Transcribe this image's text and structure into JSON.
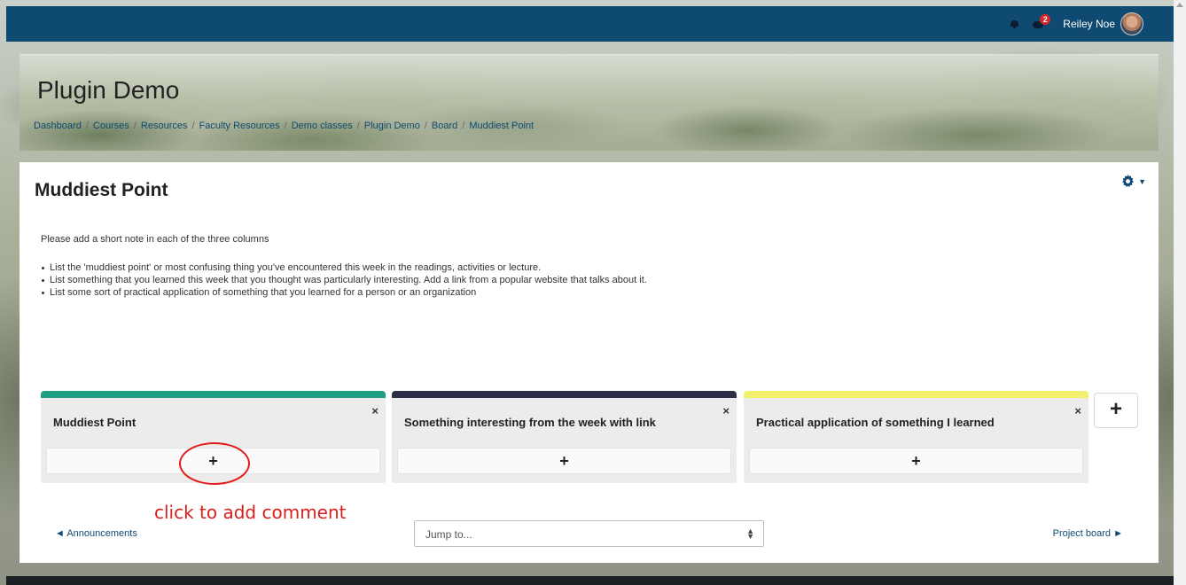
{
  "navbar": {
    "user_name": "Reiley Noe",
    "message_count": "2",
    "colors": {
      "background": "#0f4a72",
      "badge": "#d9262b"
    }
  },
  "header": {
    "page_title": "Plugin Demo",
    "breadcrumb": [
      "Dashboard",
      "Courses",
      "Resources",
      "Faculty Resources",
      "Demo classes",
      "Plugin Demo",
      "Board",
      "Muddiest Point"
    ]
  },
  "activity": {
    "title": "Muddiest Point",
    "intro": "Please add a short note in each of the three columns",
    "instructions": [
      "List the 'muddiest point' or most confusing thing you've encountered this week in the readings, activities or lecture.",
      "List something that you learned this week that you thought was particularly interesting. Add a link from a popular website that talks about it.",
      "List some sort of practical application of something that you learned for a person or an organization"
    ]
  },
  "board": {
    "columns": [
      {
        "heading": "Muddiest Point",
        "color": "#1f9e83",
        "close_glyph": "×",
        "add_glyph": "+"
      },
      {
        "heading": "Something interesting from the week with link",
        "color": "#2c2f45",
        "close_glyph": "×",
        "add_glyph": "+"
      },
      {
        "heading": "Practical application of something I learned",
        "color": "#f3f06e",
        "close_glyph": "×",
        "add_glyph": "+"
      }
    ],
    "add_column_glyph": "+"
  },
  "annotation": {
    "text": "click to add comment",
    "color": "#d81f1f"
  },
  "navigation": {
    "prev_label": "◄ Announcements",
    "next_label": "Project board ►",
    "jump_placeholder": "Jump to..."
  },
  "icons": {
    "bell": "bell-icon",
    "messages": "chat-icon",
    "settings": "gear-icon",
    "close": "close-icon",
    "add": "plus-icon"
  }
}
